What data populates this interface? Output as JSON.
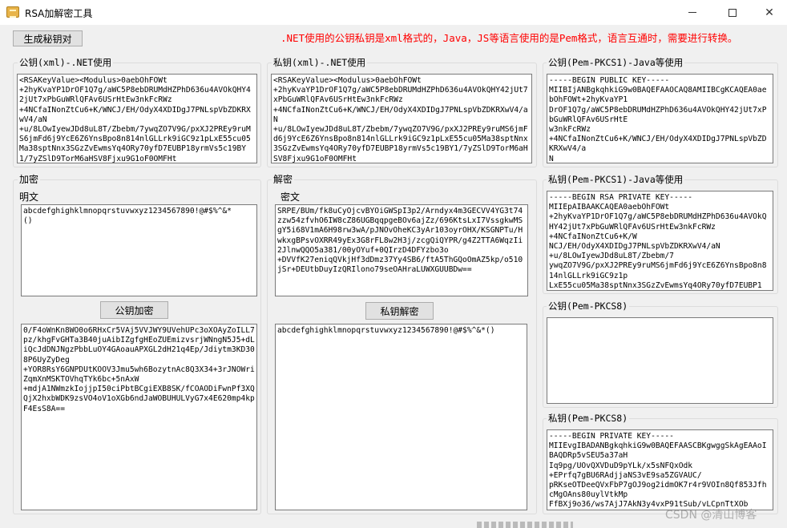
{
  "window": {
    "title": "RSA加解密工具",
    "minimize_glyph": "—",
    "close_glyph": "✕",
    "icon": "key-app-icon"
  },
  "toolbar": {
    "generate_label": "生成秘钥对",
    "notice": ".NET使用的公钥私钥是xml格式的，Java，JS等语言使用的是Pem格式，语言互通时，需要进行转换。"
  },
  "public_xml": {
    "label": "公钥(xml)-.NET使用",
    "value": "<RSAKeyValue><Modulus>0aebOhFOWt\n+2hyKvaYP1DrOF1Q7g/aWC5P8ebDRUMdHZPhD636u4AVOkQHY42jUt7xPbGuWRlQFAv6USrHtEw3nkFcRWz\n+4NCfaINonZtCu6+K/WNCJ/EH/OdyX4XDIDgJ7PNLspVbZDKRXwV4/aN\n+u/8LOwIyewJDd8uL8T/Zbebm/7ywqZO7V9G/pxXJ2PREy9ruMS6jmFd6j9YcE6Z6YnsBpo8n814nlGLLrk9iGC9z1pLxE55cu05Ma38sptNnx3SGzZvEwmsYq4ORy70yfD7EUBP18yrmVs5c19BY1/7yZSlD9TorM6aHSV8Fjxu9G1oF0OMFHt"
  },
  "private_xml": {
    "label": "私钥(xml)-.NET使用",
    "value": "<RSAKeyValue><Modulus>0aebOhFOWt\n+2hyKvaYP1DrOF1Q7g/aWC5P8ebDRUMdHZPhD636u4AVOkQHY42jUt7xPbGuWRlQFAv6USrHtEw3nkFcRWz\n+4NCfaINonZtCu6+K/WNCJ/EH/OdyX4XDIDgJ7PNLspVbZDKRXwV4/aN\n+u/8LOwIyewJDd8uL8T/Zbebm/7ywqZO7V9G/pxXJ2PREy9ruMS6jmFd6j9YcE6Z6YnsBpo8n814nlGLLrk9iGC9z1pLxE55cu05Ma38sptNnx3SGzZvEwmsYq4ORy70yfD7EUBP18yrmVs5c19BY1/7yZSlD9TorM6aHSV8Fjxu9G1oF0OMFHt"
  },
  "public_pkcs1": {
    "label": "公钥(Pem-PKCS1)-Java等使用",
    "value": "-----BEGIN PUBLIC KEY-----\nMIIBIjANBgkqhkiG9w0BAQEFAAOCAQ8AMIIBCgKCAQEA0aebOhFOWt+2hyKvaYP1\nDrOF1Q7g/aWC5P8ebDRUMdHZPhD636u4AVOkQHY42jUt7xPbGuWRlQFAv6USrHtE\nw3nkFcRWz\n+4NCfaINonZtCu6+K/WNCJ/EH/OdyX4XDIDgJ7PNLspVbZDKRXwV4/a\nN"
  },
  "private_pkcs1": {
    "label": "私钥(Pem-PKCS1)-Java等使用",
    "value": "-----BEGIN RSA PRIVATE KEY-----\nMIIEpAIBAAKCAQEA0aebOhFOWt\n+2hyKvaYP1DrOF1Q7g/aWC5P8ebDRUMdHZPhD636u4AVOkQHY42jUt7xPbGuWRlQFAv6USrHtEw3nkFcRWz\n+4NCfaINonZtCu6+K/W\nNCJ/EH/OdyX4XDIDgJ7PNLspVbZDKRXwV4/aN\n+u/8LOwIyewJDd8uL8T/Zbebm/7\nywqZO7V9G/pxXJ2PREy9ruMS6jmFd6j9YcE6Z6YnsBpo8n814nlGLLrk9iGC9z1p\nLxE55cu05Ma38sptNnx3SGzZvEwmsYq4ORy70yfD7EUBP1"
  },
  "public_pkcs8": {
    "label": "公钥(Pem-PKCS8)",
    "value": ""
  },
  "private_pkcs8": {
    "label": "私钥(Pem-PKCS8)",
    "value": "-----BEGIN PRIVATE KEY-----\nMIIEvgIBADANBgkqhkiG9w0BAQEFAASCBKgwggSkAgEAAoIBAQDRp5vSEU5a37aH\nIq9pg/UOvQXVDuD9pYLk/x5sNFQxOdk\n+EPrfq7gBU6RAdjjaNS3vE9sa5ZGVAUC/\npRKseOTDeeQVxFbP7gOJ9og2idmOK7r4r9VOIn8Qf853JfhcMgOAns80uylVtkMp\nFfBXj9o36/ws7AjJ7AkN3y4vxP91tSub/vLCpnTtXOb"
  },
  "encrypt": {
    "group_label": "加密",
    "plaintext_label": "明文",
    "plaintext": "abcdefghighklmnopqrstuvwxyz1234567890!@#$%^&*\n()",
    "button_label": "公钥加密",
    "ciphertext": "0/F4oWnKn8WO0o6RHxCr5VAj5VVJWY9UVehUPc3oXOAyZoILL7pz/khgFvGHTa3B40juAibIZgfgHEoZUEmizvsrjWNngN5J5+dLiQcJdDNJNgzPbbLuOY4GAoauAPXGL2dH21q4Ep/Jdiytm3KD308P6UyZyDeg\n+YOR8RsY6GNPDUtKOOV3Jmu5wh6BozytnAc8Q3X34+3rJNOWriZqmXnMSKTOVhqTYk6bc+5nAxW\n+mdjA1NWmzkIojjpI50ciPbtBCgiEXB8SK/fCOAODiFwnPf3XQQjX2hxbWDK9zsVO4oV1oXGb6ndJaWOBUHULVyG7x4E620mp4kpF4EsS8A=="
  },
  "decrypt": {
    "group_label": "解密",
    "ciphertext_label": "密文",
    "ciphertext": "SRPE/BUm/fk8uCyOjcvBYOiGWSpI3p2/Arndyx4m3GECVV4YG3t74zzw54zfvhO6IW8cZ86UGBqqpgeBOv6ajZz/696KtsLxI7VssgkwMSgY5i68V1mA6H98rw3wA/pJNOvOheKC3yAr103oyrOHX/KSGNPTu/HwkxgBPsvOXRR49yEx3G8rFL8w2H3j/zcgQiQYPR/g4Z2TTA6WqzIi2JlnwQQO5a381/00yOYuf+0QIrzD4DFYzbo3o\n+DVVfK27eniqQVkjHf3dDmz37Yy4SB6/ftA5ThGQoOmAZ5kp/o510jSr+DEUtbDuyIzQRIlono79seOAHraLUWXGUUBDw==",
    "button_label": "私钥解密",
    "plaintext": "abcdefghighklmnopqrstuvwxyz1234567890!@#$%^&*()"
  },
  "watermark": "CSDN @清山博客"
}
